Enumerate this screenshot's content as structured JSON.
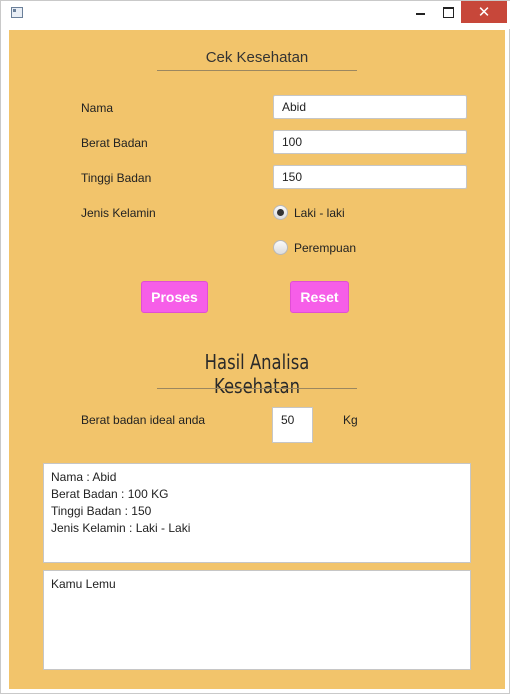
{
  "window": {
    "title_icon": "app-window-icon",
    "minimize_icon": "minimize-icon",
    "maximize_icon": "maximize-icon",
    "close_icon": "close-icon"
  },
  "form": {
    "title": "Cek Kesehatan",
    "nama_label": "Nama",
    "nama_value": "Abid",
    "berat_label": "Berat Badan",
    "berat_value": "100",
    "tinggi_label": "Tinggi Badan",
    "tinggi_value": "150",
    "jenis_label": "Jenis Kelamin",
    "gender_options": [
      {
        "label": "Laki - laki",
        "checked": true
      },
      {
        "label": "Perempuan",
        "checked": false
      }
    ],
    "proses_label": "Proses",
    "reset_label": "Reset"
  },
  "result": {
    "title": "Hasil Analisa Kesehatan",
    "ideal_label": "Berat badan ideal anda",
    "ideal_value": "50",
    "ideal_unit": "Kg",
    "summary_lines": [
      "Nama : Abid",
      "Berat Badan : 100 KG",
      "Tinggi Badan : 150",
      "Jenis Kelamin : Laki - Laki"
    ],
    "verdict": "Kamu Lemu"
  },
  "colors": {
    "panel": "#f2c46b",
    "button": "#f65ee8",
    "close": "#c7473a"
  }
}
